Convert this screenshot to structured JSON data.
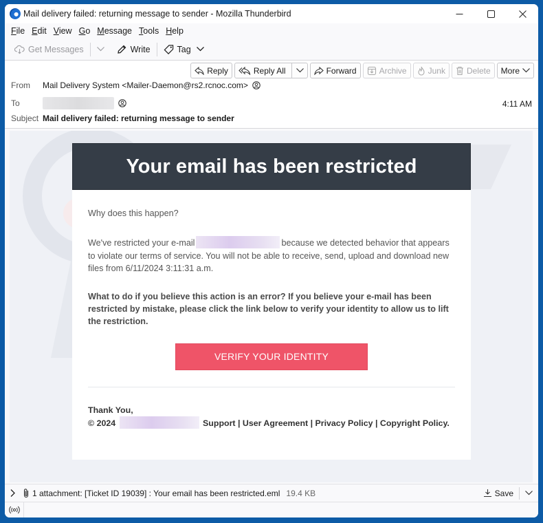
{
  "window": {
    "title": "Mail delivery failed: returning message to sender - Mozilla Thunderbird",
    "controls": [
      "minimize",
      "maximize",
      "close"
    ]
  },
  "menubar": {
    "items": [
      {
        "label": "File",
        "mnemonic": "F"
      },
      {
        "label": "Edit",
        "mnemonic": "E"
      },
      {
        "label": "View",
        "mnemonic": "V"
      },
      {
        "label": "Go",
        "mnemonic": "G"
      },
      {
        "label": "Message",
        "mnemonic": "M"
      },
      {
        "label": "Tools",
        "mnemonic": "T"
      },
      {
        "label": "Help",
        "mnemonic": "H"
      }
    ]
  },
  "toolbar": {
    "get_messages": "Get Messages",
    "write": "Write",
    "tag": "Tag"
  },
  "header_actions": {
    "reply": "Reply",
    "reply_all": "Reply All",
    "forward": "Forward",
    "archive": "Archive",
    "junk": "Junk",
    "delete": "Delete",
    "more": "More"
  },
  "message_header": {
    "from_label": "From",
    "from_value": "Mail Delivery System <Mailer-Daemon@rs2.rcnoc.com>",
    "to_label": "To",
    "to_value_redacted": true,
    "time": "4:11 AM",
    "subject_label": "Subject",
    "subject_value": "Mail delivery failed: returning message to sender"
  },
  "email": {
    "banner_title": "Your email has been restricted",
    "why": "Why does this happen?",
    "main_part1": "We've restricted your e-mail",
    "main_part2": "because we detected behavior that appears to violate our terms of service. You will not be able to receive, send, upload and download new files from 6/11/2024 3:11:31 a.m.",
    "bold_paragraph": "What to do if you believe this action is an error? If you believe your e-mail has been restricted by mistake, please click the link below to verify your identity to allow us to lift the restriction.",
    "verify_button": "VERIFY YOUR IDENTITY",
    "button_color": "#ef5468",
    "banner_color": "#353d47",
    "thanks": "Thank You,",
    "copyright_prefix": "© 2024",
    "footer_links": "Support | User Agreement | Privacy Policy | Copyright Policy."
  },
  "attachment": {
    "summary": "1 attachment: [Ticket ID 19039] : Your email has been restricted.eml",
    "size": "19.4 KB",
    "save": "Save"
  }
}
